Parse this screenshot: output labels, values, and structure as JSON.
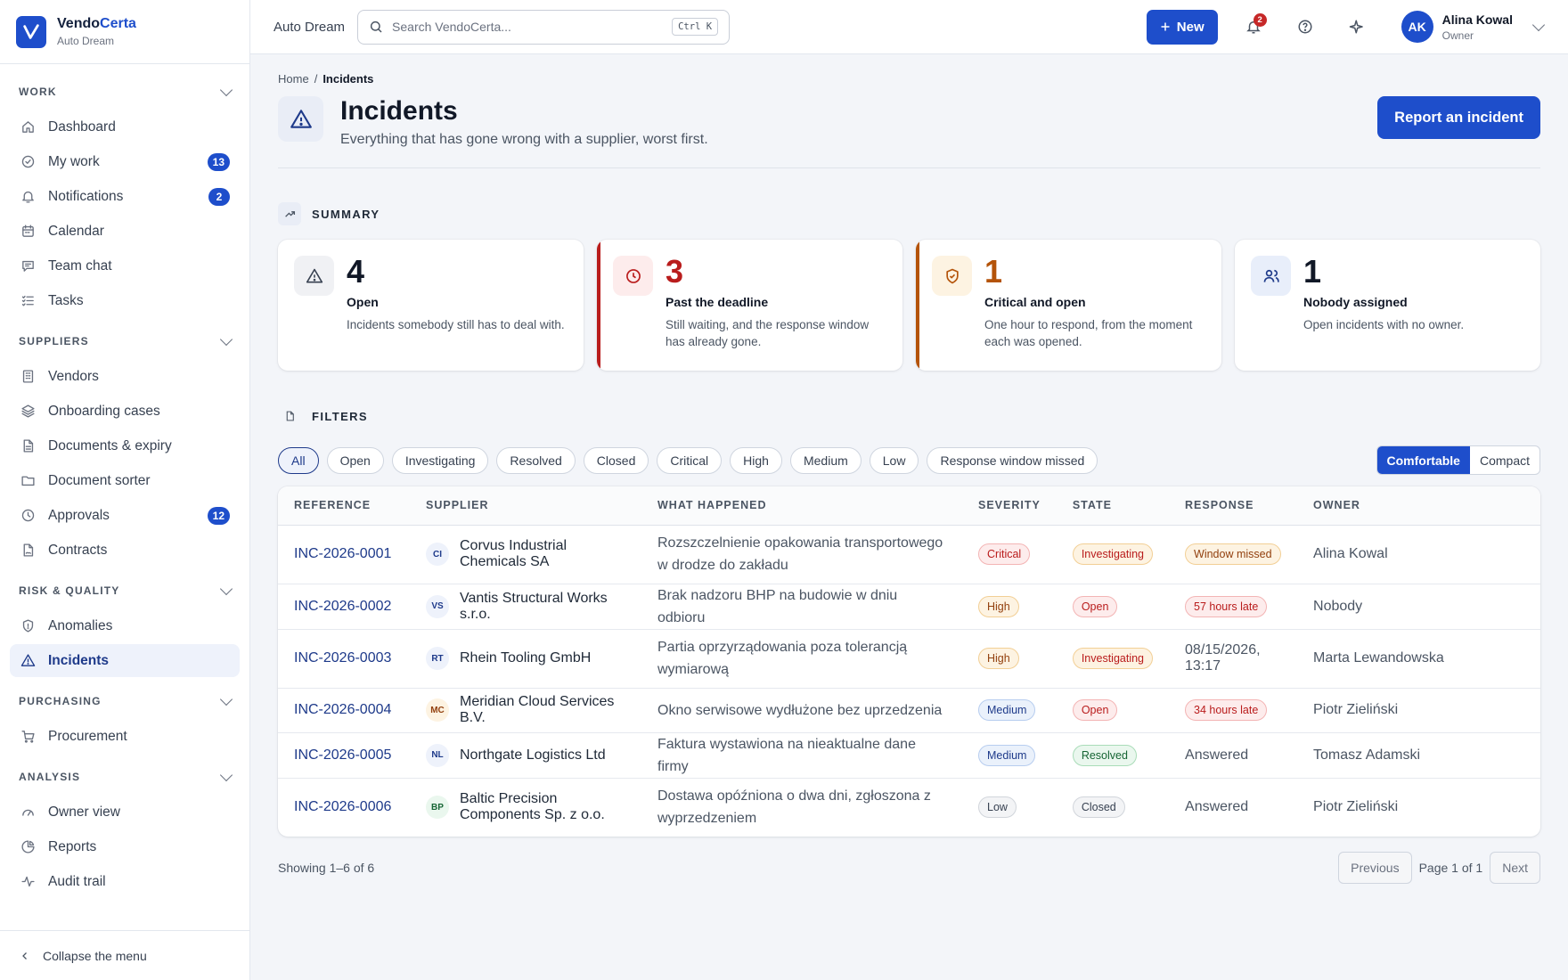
{
  "brand": {
    "name_main": "Vendo",
    "name_accent": "Certa",
    "org": "Auto Dream"
  },
  "sidebar": {
    "sections": [
      {
        "label": "WORK",
        "items": [
          {
            "label": "Dashboard",
            "icon": "home-icon"
          },
          {
            "label": "My work",
            "icon": "check-circle-icon",
            "badge": "13"
          },
          {
            "label": "Notifications",
            "icon": "bell-icon",
            "badge": "2"
          },
          {
            "label": "Calendar",
            "icon": "calendar-icon"
          },
          {
            "label": "Team chat",
            "icon": "chat-icon"
          },
          {
            "label": "Tasks",
            "icon": "list-check-icon"
          }
        ]
      },
      {
        "label": "SUPPLIERS",
        "items": [
          {
            "label": "Vendors",
            "icon": "building-icon"
          },
          {
            "label": "Onboarding cases",
            "icon": "layers-icon"
          },
          {
            "label": "Documents & expiry",
            "icon": "document-icon"
          },
          {
            "label": "Document sorter",
            "icon": "folder-icon"
          },
          {
            "label": "Approvals",
            "icon": "clock-icon",
            "badge": "12"
          },
          {
            "label": "Contracts",
            "icon": "contract-icon"
          }
        ]
      },
      {
        "label": "RISK & QUALITY",
        "items": [
          {
            "label": "Anomalies",
            "icon": "shield-icon"
          },
          {
            "label": "Incidents",
            "icon": "warning-icon",
            "active": true
          }
        ]
      },
      {
        "label": "PURCHASING",
        "items": [
          {
            "label": "Procurement",
            "icon": "cart-icon"
          }
        ]
      },
      {
        "label": "ANALYSIS",
        "items": [
          {
            "label": "Owner view",
            "icon": "gauge-icon"
          },
          {
            "label": "Reports",
            "icon": "pie-chart-icon"
          },
          {
            "label": "Audit trail",
            "icon": "activity-icon"
          }
        ]
      }
    ],
    "collapse_label": "Collapse the menu"
  },
  "topbar": {
    "org": "Auto Dream",
    "search_placeholder": "Search VendoCerta...",
    "search_shortcut": "Ctrl K",
    "new_label": "New",
    "notif_count": "2",
    "user": {
      "initials": "AK",
      "name": "Alina Kowal",
      "role": "Owner"
    }
  },
  "page": {
    "breadcrumb": {
      "home": "Home",
      "sep": "/",
      "current": "Incidents"
    },
    "title": "Incidents",
    "subtitle": "Everything that has gone wrong with a supplier, worst first.",
    "report_label": "Report an incident"
  },
  "summary": {
    "label": "SUMMARY",
    "cards": [
      {
        "value": "4",
        "title": "Open",
        "desc": "Incidents somebody still has to deal with."
      },
      {
        "value": "3",
        "title": "Past the deadline",
        "desc": "Still waiting, and the response window has already gone."
      },
      {
        "value": "1",
        "title": "Critical and open",
        "desc": "One hour to respond, from the moment each was opened."
      },
      {
        "value": "1",
        "title": "Nobody assigned",
        "desc": "Open incidents with no owner."
      }
    ]
  },
  "filters": {
    "label": "FILTERS",
    "chips": [
      "All",
      "Open",
      "Investigating",
      "Resolved",
      "Closed",
      "Critical",
      "High",
      "Medium",
      "Low",
      "Response window missed"
    ],
    "active": "All",
    "density": [
      "Comfortable",
      "Compact"
    ],
    "density_active": "Comfortable"
  },
  "table": {
    "columns": [
      "REFERENCE",
      "SUPPLIER",
      "WHAT HAPPENED",
      "SEVERITY",
      "STATE",
      "RESPONSE",
      "OWNER"
    ],
    "rows": [
      {
        "ref": "INC-2026-0001",
        "initials": "CI",
        "supplier": "Corvus Industrial Chemicals SA",
        "what": "Rozszczelnienie opakowania transportowego w drodze do zakładu",
        "severity": "Critical",
        "state": "Investigating",
        "response": "Window missed",
        "response_kind": "amber",
        "owner": "Alina Kowal"
      },
      {
        "ref": "INC-2026-0002",
        "initials": "VS",
        "supplier": "Vantis Structural Works s.r.o.",
        "what": "Brak nadzoru BHP na budowie w dniu odbioru",
        "severity": "High",
        "state": "Open",
        "response": "57 hours late",
        "response_kind": "red",
        "owner": "Nobody"
      },
      {
        "ref": "INC-2026-0003",
        "initials": "RT",
        "supplier": "Rhein Tooling GmbH",
        "what": "Partia oprzyrządowania poza tolerancją wymiarową",
        "severity": "High",
        "state": "Investigating",
        "response": "08/15/2026, 13:17",
        "response_kind": "text",
        "owner": "Marta Lewandowska"
      },
      {
        "ref": "INC-2026-0004",
        "initials": "MC",
        "supplier": "Meridian Cloud Services B.V.",
        "what": "Okno serwisowe wydłużone bez uprzedzenia",
        "severity": "Medium",
        "state": "Open",
        "response": "34 hours late",
        "response_kind": "red",
        "owner": "Piotr Zieliński"
      },
      {
        "ref": "INC-2026-0005",
        "initials": "NL",
        "supplier": "Northgate Logistics Ltd",
        "what": "Faktura wystawiona na nieaktualne dane firmy",
        "severity": "Medium",
        "state": "Resolved",
        "response": "Answered",
        "response_kind": "text",
        "owner": "Tomasz Adamski"
      },
      {
        "ref": "INC-2026-0006",
        "initials": "BP",
        "supplier": "Baltic Precision Components Sp. z o.o.",
        "what": "Dostawa opóźniona o dwa dni, zgłoszona z wyprzedzeniem",
        "severity": "Low",
        "state": "Closed",
        "response": "Answered",
        "response_kind": "text",
        "owner": "Piotr Zieliński"
      }
    ]
  },
  "footer": {
    "showing": "Showing 1–6 of 6",
    "previous": "Previous",
    "page_info": "Page 1 of 1",
    "next": "Next"
  },
  "colors": {
    "accent": "#1e4ecb",
    "critical": "#b91c1c",
    "warning": "#b45309"
  }
}
